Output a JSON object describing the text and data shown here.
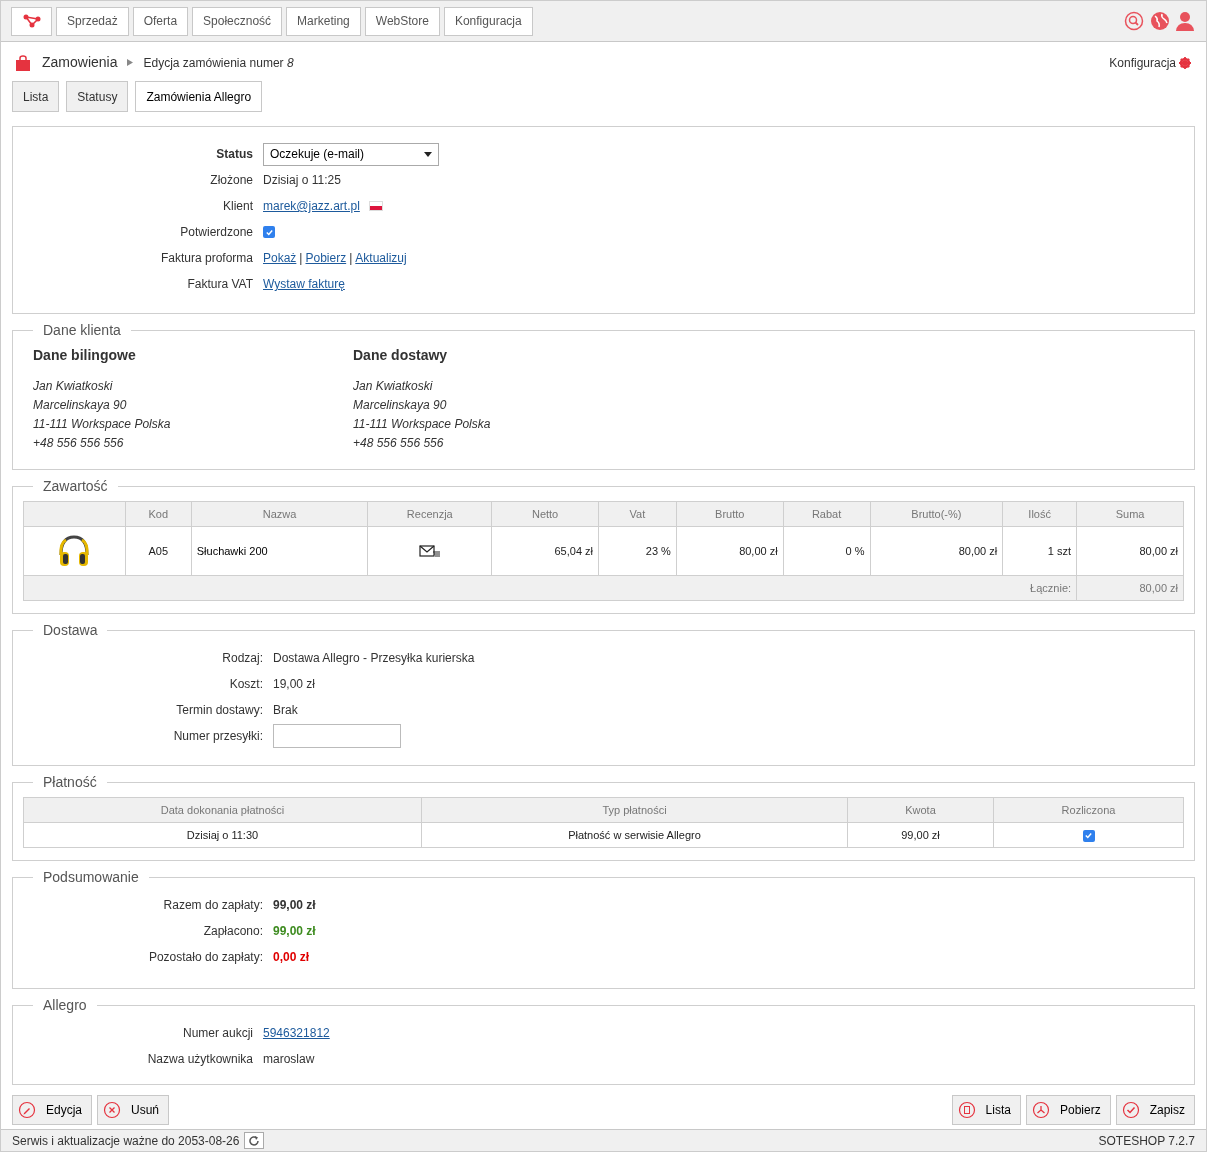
{
  "top_nav": {
    "items": [
      "Sprzedaż",
      "Oferta",
      "Społeczność",
      "Marketing",
      "WebStore",
      "Konfiguracja"
    ]
  },
  "breadcrumb": {
    "section": "Zamowienia",
    "page": "Edycja zamówienia numer *8*",
    "config_link": "Konfiguracja"
  },
  "tabs": [
    {
      "label": "Lista",
      "selected": false
    },
    {
      "label": "Statusy",
      "selected": false
    },
    {
      "label": "Zamówienia Allegro",
      "selected": true
    }
  ],
  "order": [
    {
      "label": "Status",
      "kind": "select",
      "value": "Oczekuje (e-mail)"
    },
    {
      "label": "Złożone",
      "kind": "text",
      "value": "Dzisiaj o 11:25"
    },
    {
      "label": "Klient",
      "kind": "link_flag",
      "value": "marek@jazz.art.pl"
    },
    {
      "label": "Potwierdzone",
      "kind": "checkbox",
      "checked": true
    },
    {
      "label": "Faktura proforma",
      "kind": "links",
      "links": [
        "Pokaż",
        "Pobierz",
        "Aktualizuj"
      ],
      "separator": "|"
    },
    {
      "label": "Faktura VAT",
      "kind": "links",
      "links": [
        "Wystaw fakturę"
      ]
    }
  ],
  "client": {
    "title": "Dane klienta",
    "blocks": [
      {
        "title": "Dane bilingowe",
        "lines": [
          "Jan Kwiatkoski",
          "Marcelinskaya 90",
          "11-111 Workspace Polska",
          "+48 556 556 556"
        ]
      },
      {
        "title": "Dane dostawy",
        "lines": [
          "Jan Kwiatkoski",
          "Marcelinskaya 90",
          "11-111 Workspace Polska",
          "+48 556 556 556"
        ]
      }
    ]
  },
  "contents": {
    "title": "Zawartość",
    "columns": [
      "Kod",
      "Nazwa",
      "Recenzja",
      "Netto",
      "Vat",
      "Brutto",
      "Rabat",
      "Brutto(-%)",
      "Ilość",
      "Suma"
    ],
    "rows": [
      {
        "code": "A05",
        "name": "Słuchawki 200",
        "netto": "65,04 zł",
        "vat": "23 %",
        "brutto": "80,00 zł",
        "rabat": "0 %",
        "brutto_disc": "80,00 zł",
        "qty": "1 szt",
        "sum": "80,00 zł"
      }
    ],
    "total_label": "Łącznie:",
    "total_value": "80,00 zł"
  },
  "delivery": {
    "title": "Dostawa",
    "fields": [
      {
        "label": "Rodzaj:",
        "kind": "text",
        "value": "Dostawa Allegro - Przesyłka kurierska"
      },
      {
        "label": "Koszt:",
        "kind": "text",
        "value": "19,00 zł"
      },
      {
        "label": "Termin dostawy:",
        "kind": "text",
        "value": "Brak"
      },
      {
        "label": "Numer przesyłki:",
        "kind": "input"
      }
    ]
  },
  "payment": {
    "title": "Płatność",
    "columns": [
      "Data dokonania płatności",
      "Typ płatności",
      "Kwota",
      "Rozliczona"
    ],
    "rows": [
      {
        "date": "Dzisiaj o 11:30",
        "type": "Płatność w serwisie Allegro",
        "amount": "99,00 zł",
        "settled": true
      }
    ]
  },
  "summary": {
    "title": "Podsumowanie",
    "rows": [
      {
        "label": "Razem do zapłaty:",
        "value": "99,00 zł",
        "color": "#333333"
      },
      {
        "label": "Zapłacono:",
        "value": "99,00 zł",
        "color": "#3d8b1f"
      },
      {
        "label": "Pozostało do zapłaty:",
        "value": "0,00 zł",
        "color": "#e00000"
      }
    ]
  },
  "allegro": {
    "title": "Allegro",
    "fields": [
      {
        "label": "Numer aukcji",
        "kind": "link",
        "value": "5946321812"
      },
      {
        "label": "Nazwa użytkownika",
        "kind": "text",
        "value": "maroslaw"
      }
    ]
  },
  "actions": {
    "left": [
      {
        "label": "Edycja",
        "kind": "edit"
      },
      {
        "label": "Usuń",
        "kind": "delete"
      }
    ],
    "right": [
      {
        "label": "Lista",
        "kind": "list"
      },
      {
        "label": "Pobierz",
        "kind": "download"
      },
      {
        "label": "Zapisz",
        "kind": "save"
      }
    ]
  },
  "status_bar": {
    "service": "Serwis i aktualizacje ważne do 2053-08-26",
    "version": "SOTESHOP 7.2.7"
  }
}
